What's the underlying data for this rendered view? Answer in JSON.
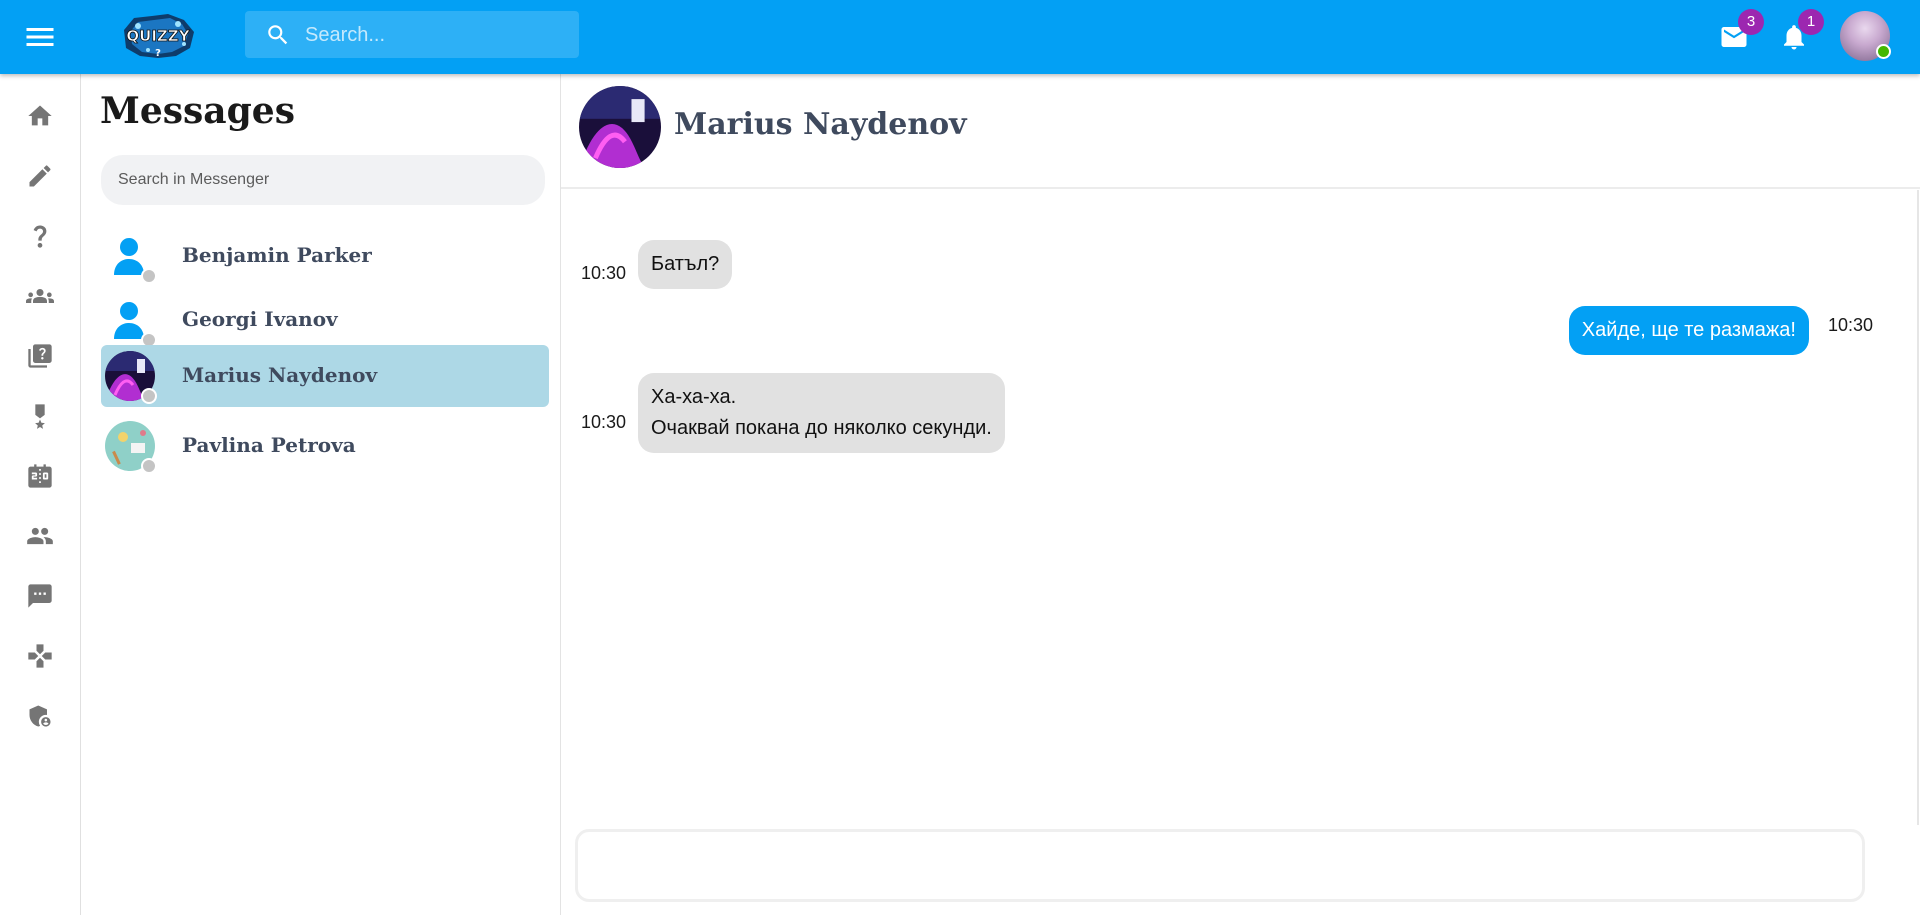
{
  "header": {
    "search_placeholder": "Search...",
    "logo_text": "QUIZZY",
    "mail_badge": "3",
    "notifications_badge": "1"
  },
  "sidebar": {
    "items": [
      {
        "icon": "home-icon"
      },
      {
        "icon": "pencil-icon"
      },
      {
        "icon": "question-icon"
      },
      {
        "icon": "groups-icon"
      },
      {
        "icon": "quiz-library-icon"
      },
      {
        "icon": "award-icon"
      },
      {
        "icon": "scoreboard-icon"
      },
      {
        "icon": "people-icon"
      },
      {
        "icon": "chat-icon"
      },
      {
        "icon": "gamepad-icon"
      },
      {
        "icon": "admin-shield-icon"
      }
    ]
  },
  "messages_panel": {
    "title": "Messages",
    "search_placeholder": "Search in Messenger",
    "contacts": [
      {
        "name": "Benjamin Parker",
        "active": false,
        "status": "offline"
      },
      {
        "name": "Georgi Ivanov",
        "active": false,
        "status": "offline"
      },
      {
        "name": "Marius Naydenov",
        "active": true,
        "status": "offline"
      },
      {
        "name": "Pavlina Petrova",
        "active": false,
        "status": "offline"
      }
    ]
  },
  "chat": {
    "contact_name": "Marius Naydenov",
    "messages": [
      {
        "direction": "in",
        "time": "10:30",
        "lines": [
          "Батъл?"
        ]
      },
      {
        "direction": "out",
        "time": "10:30",
        "lines": [
          "Хайде, ще те размажа!"
        ]
      },
      {
        "direction": "in",
        "time": "10:30",
        "lines": [
          "Ха-ха-ха.",
          "Очаквай покана до няколко секунди."
        ]
      }
    ],
    "composer_placeholder": ""
  },
  "colors": {
    "primary": "#03a0f4",
    "active_contact": "#add8e6",
    "incoming_bubble": "#e1e1e1",
    "badge": "#9c27b0",
    "online": "#44b700",
    "offline": "#c4c4c4"
  }
}
